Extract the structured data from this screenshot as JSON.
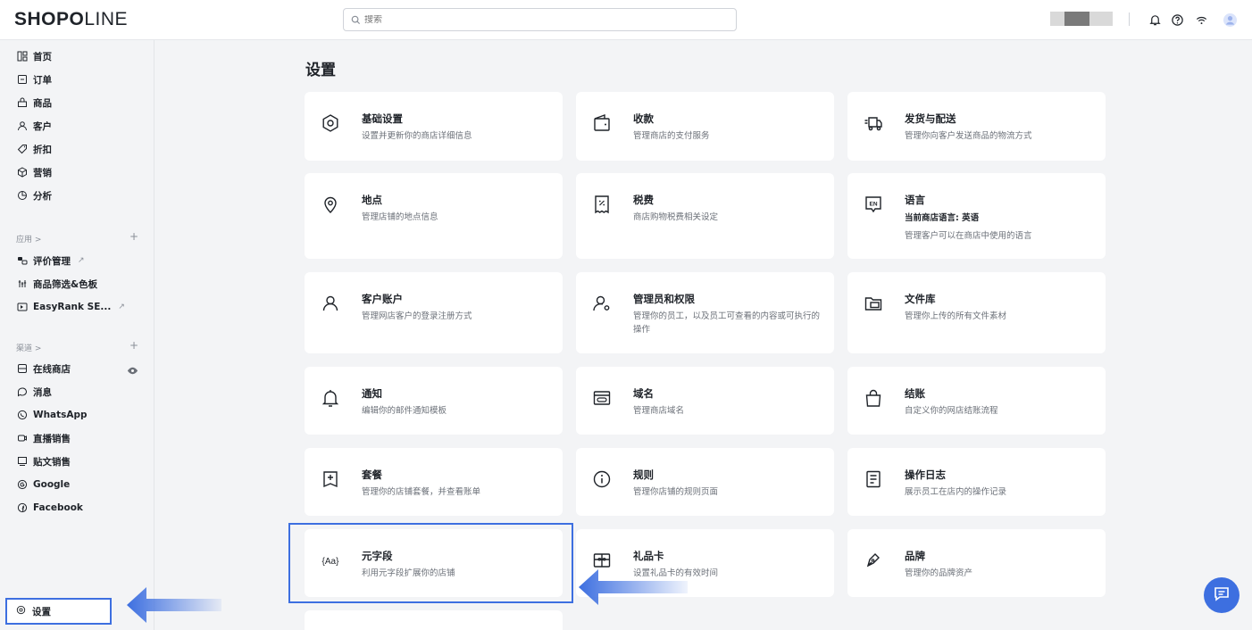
{
  "brand": {
    "logo_bold": "SHOP",
    "logo_o": "O",
    "logo_thin": "LINE"
  },
  "search": {
    "placeholder": "搜索"
  },
  "sidebar": {
    "main": [
      {
        "label": "首页",
        "icon": "home-icon"
      },
      {
        "label": "订单",
        "icon": "order-icon"
      },
      {
        "label": "商品",
        "icon": "product-icon"
      },
      {
        "label": "客户",
        "icon": "customer-icon"
      },
      {
        "label": "折扣",
        "icon": "discount-icon"
      },
      {
        "label": "营销",
        "icon": "marketing-icon"
      },
      {
        "label": "分析",
        "icon": "analytics-icon"
      }
    ],
    "apps_label": "应用 >",
    "apps": [
      {
        "label": "评价管理",
        "icon": "review-icon"
      },
      {
        "label": "商品筛选&色板",
        "icon": "filter-icon"
      },
      {
        "label": "EasyRank SE...",
        "icon": "easyrank-icon"
      }
    ],
    "channels_label": "渠道 >",
    "channels": [
      {
        "label": "在线商店",
        "icon": "store-icon"
      },
      {
        "label": "消息",
        "icon": "message-icon"
      },
      {
        "label": "WhatsApp",
        "icon": "whatsapp-icon"
      },
      {
        "label": "直播销售",
        "icon": "live-icon"
      },
      {
        "label": "贴文销售",
        "icon": "post-icon"
      },
      {
        "label": "Google",
        "icon": "google-icon"
      },
      {
        "label": "Facebook",
        "icon": "facebook-icon"
      }
    ],
    "plus": "+",
    "settings_label": "设置"
  },
  "main": {
    "title": "设置",
    "cards": [
      {
        "title": "基础设置",
        "desc": "设置并更新你的商店详细信息",
        "icon": "gear-icon"
      },
      {
        "title": "收款",
        "desc": "管理商店的支付服务",
        "icon": "wallet-icon"
      },
      {
        "title": "发货与配送",
        "desc": "管理你向客户发送商品的物流方式",
        "icon": "truck-icon"
      },
      {
        "title": "地点",
        "desc": "管理店铺的地点信息",
        "icon": "location-icon"
      },
      {
        "title": "税费",
        "desc": "商店购物税费相关设定",
        "icon": "tax-icon"
      },
      {
        "title": "语言",
        "extra": "当前商店语言: 英语",
        "desc": "管理客户可以在商店中使用的语言",
        "icon": "language-icon"
      },
      {
        "title": "客户账户",
        "desc": "管理网店客户的登录注册方式",
        "icon": "user-icon"
      },
      {
        "title": "管理员和权限",
        "desc": "管理你的员工，以及员工可查看的内容或可执行的操作",
        "icon": "admin-icon"
      },
      {
        "title": "文件库",
        "desc": "管理你上传的所有文件素材",
        "icon": "folder-icon"
      },
      {
        "title": "通知",
        "desc": "编辑你的邮件通知模板",
        "icon": "bell-icon"
      },
      {
        "title": "域名",
        "desc": "管理商店域名",
        "icon": "domain-icon"
      },
      {
        "title": "结账",
        "desc": "自定义你的网店结账流程",
        "icon": "bag-icon"
      },
      {
        "title": "套餐",
        "desc": "管理你的店铺套餐，并查看账单",
        "icon": "plan-icon"
      },
      {
        "title": "规则",
        "desc": "管理你店铺的规则页面",
        "icon": "info-icon"
      },
      {
        "title": "操作日志",
        "desc": "展示员工在店内的操作记录",
        "icon": "log-icon"
      },
      {
        "title": "元字段",
        "desc": "利用元字段扩展你的店铺",
        "icon": "metafield-icon"
      },
      {
        "title": "礼品卡",
        "desc": "设置礼品卡的有效时间",
        "icon": "gift-card-icon"
      },
      {
        "title": "品牌",
        "desc": "管理你的品牌资产",
        "icon": "brand-icon"
      }
    ]
  },
  "colors": {
    "accent": "#3d6fe0",
    "background": "#f3f4f6"
  }
}
